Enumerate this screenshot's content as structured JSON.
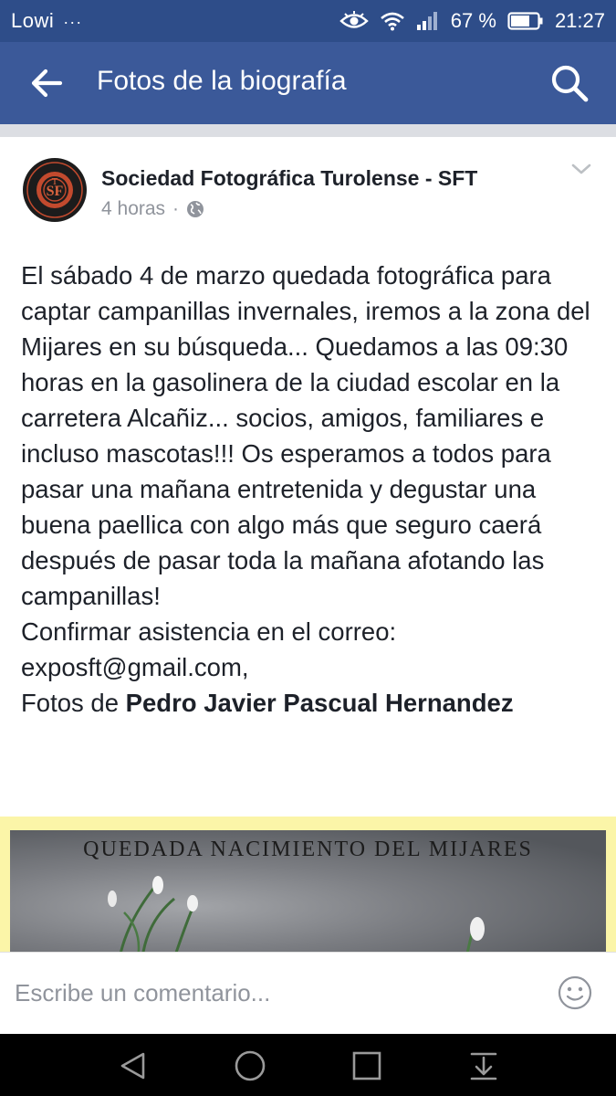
{
  "status_bar": {
    "carrier": "Lowi",
    "dots": "···",
    "battery_percent": "67 %",
    "time": "21:27"
  },
  "app_bar": {
    "title": "Fotos de la biografía",
    "back_icon": "arrow-left-icon",
    "search_icon": "search-icon"
  },
  "post": {
    "page_name": "Sociedad Fotográfica Turolense - SFT",
    "time_ago": "4 horas",
    "separator": "·",
    "privacy_icon": "globe-icon",
    "menu_icon": "chevron-down-icon",
    "body_main": "El sábado 4 de marzo quedada fotográfica para captar campanillas invernales, iremos a la zona del Mijares en su búsqueda... Quedamos a las 09:30 horas en la gasolinera de la ciudad escolar en la carretera Alcañiz... socios, amigos, familiares e incluso mascotas!!! Os esperamos a todos para pasar una mañana entretenida y degustar una buena paellica con algo más que seguro caerá después de pasar toda la mañana afotando las campanillas!",
    "confirm_line": "Confirmar asistencia en el correo:",
    "email_line": "exposft@gmail.com,",
    "credit_prefix": "Fotos de ",
    "credit_name": "Pedro Javier Pascual Hernandez",
    "photo_title": "QUEDADA NACIMIENTO DEL MIJARES",
    "avatar_text": "SOCIEDAD FOTOGRAFICA TUROLENSE"
  },
  "comment": {
    "placeholder": "Escribe un comentario...",
    "emoji_icon": "smiley-icon"
  },
  "nav_bar": {
    "back_icon": "triangle-back-icon",
    "home_icon": "circle-home-icon",
    "recents_icon": "square-recents-icon",
    "notifications_icon": "pull-down-icon"
  },
  "colors": {
    "status_bar": "#2e4d89",
    "app_bar": "#3b5999",
    "photo_border": "#fbf5a8"
  }
}
